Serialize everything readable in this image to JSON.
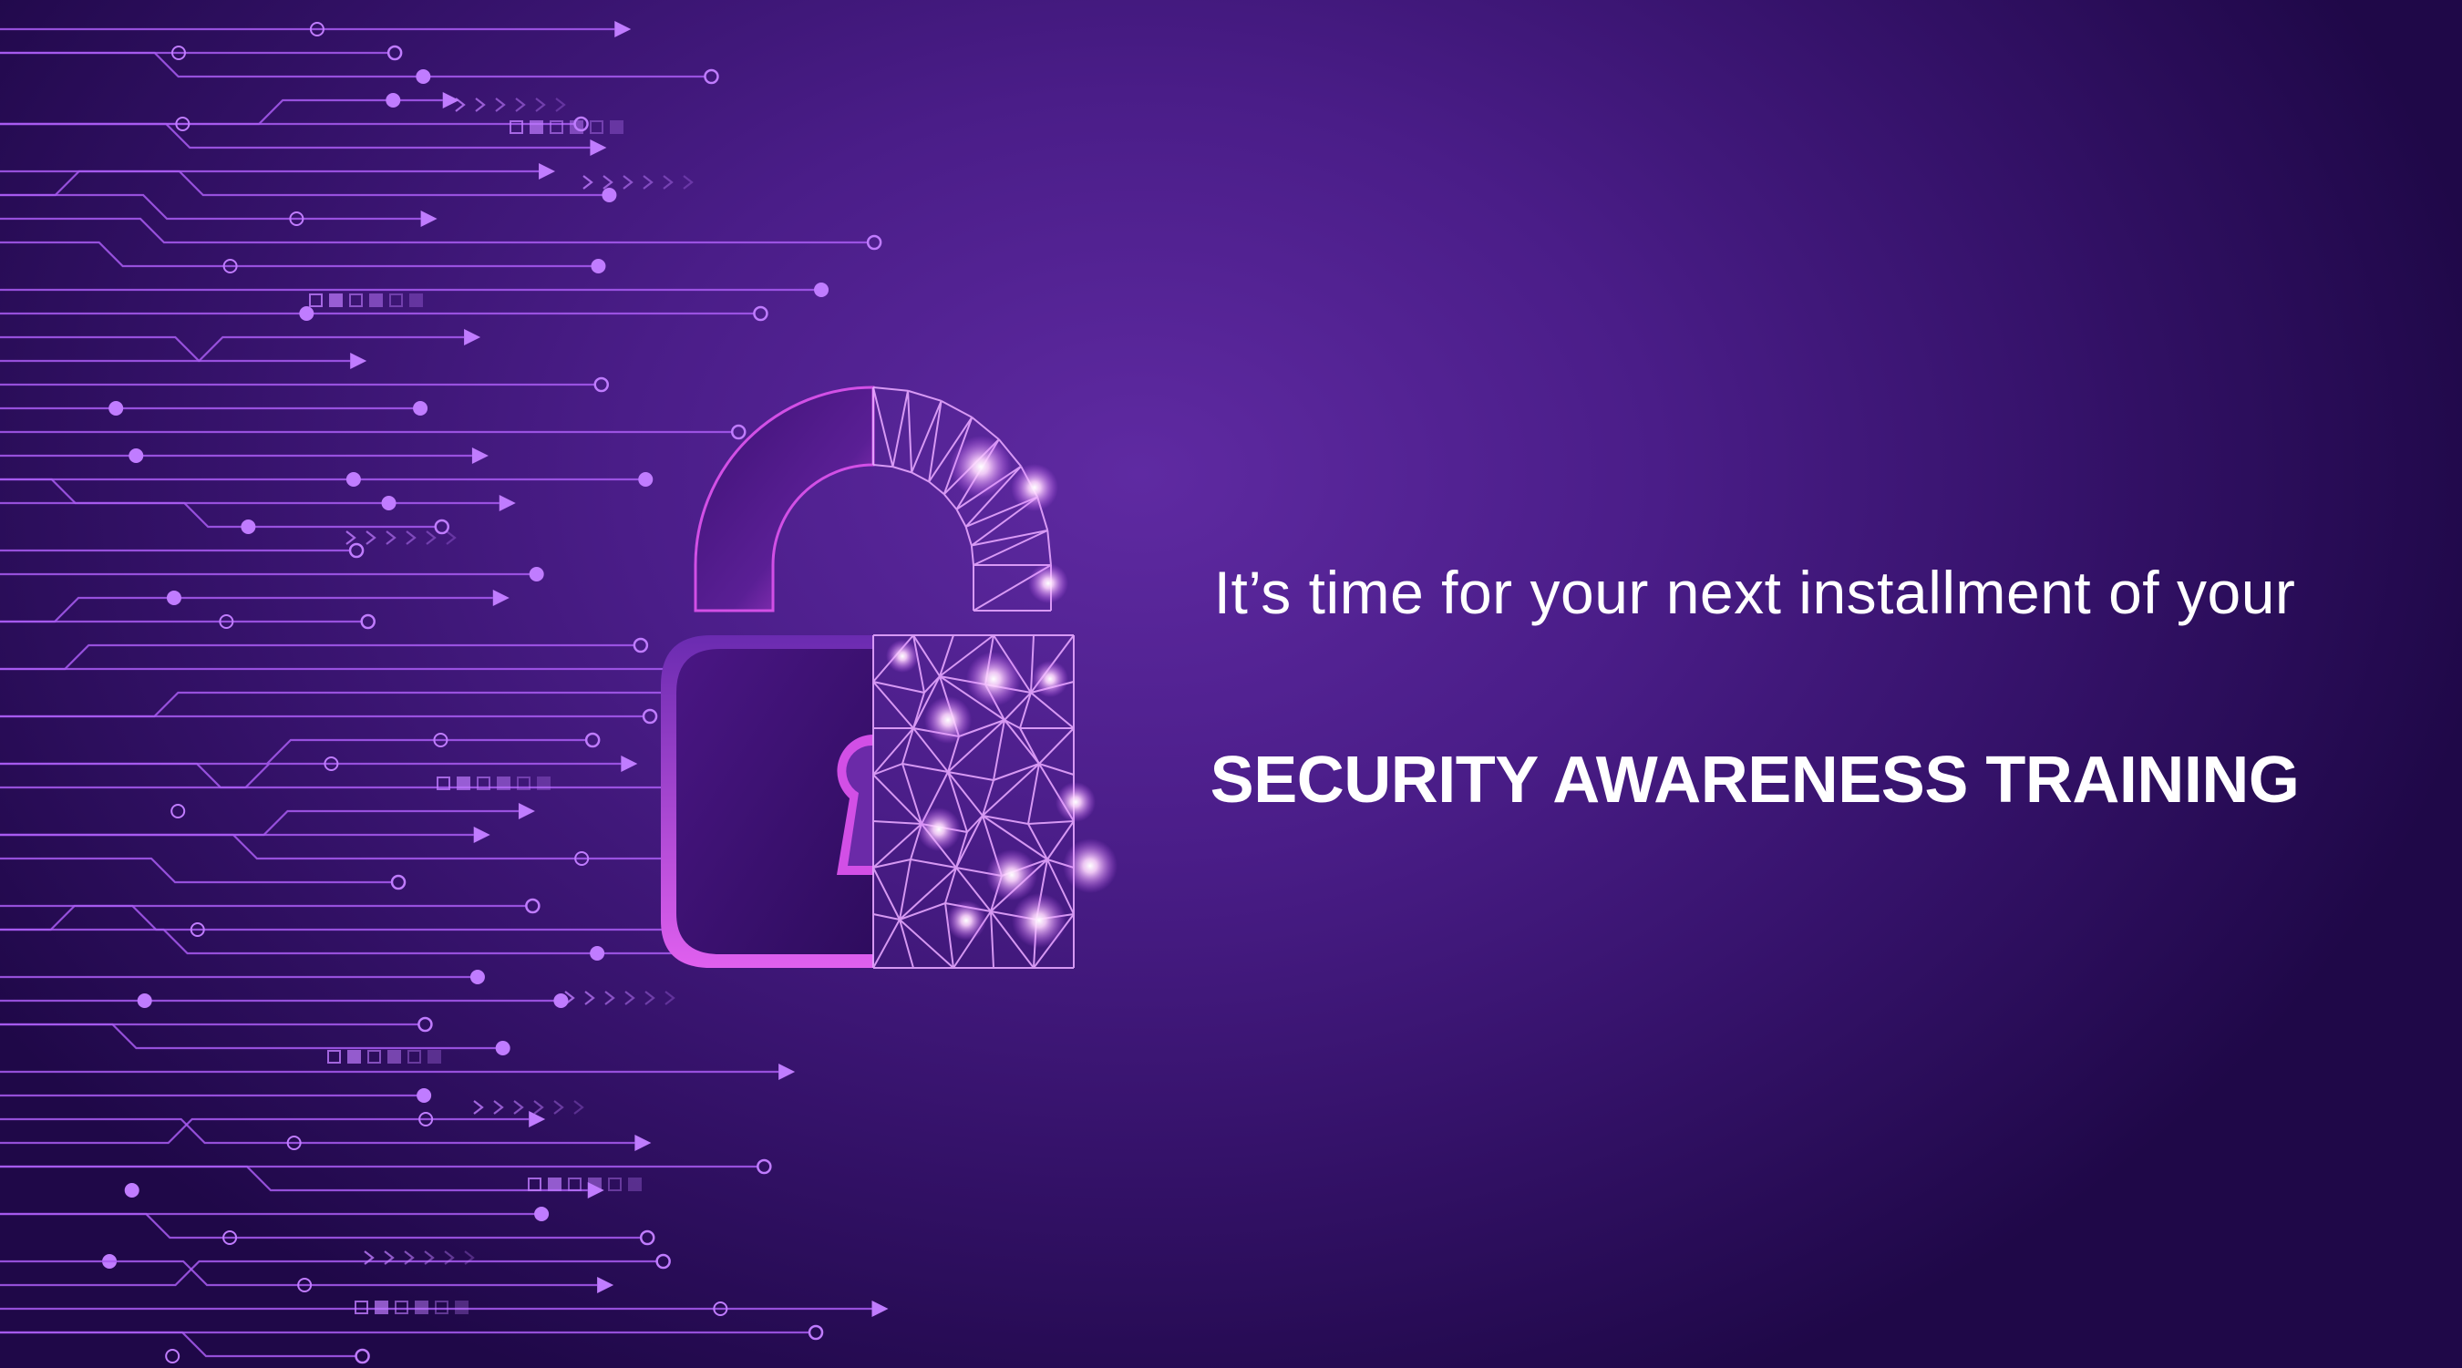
{
  "banner": {
    "intro_text": "It’s time for your next installment of your",
    "title_text": "SECURITY AWARENESS TRAINING"
  },
  "colors": {
    "background_center": "#5f2aa2",
    "background_edge": "#1f0848",
    "circuit": "#a95cf2",
    "circuit_bright": "#c07cff",
    "lock_magenta": "#d24fe6",
    "text": "#ffffff"
  },
  "icons": {
    "lock": "padlock-icon",
    "circuit": "circuit-board-lines"
  }
}
